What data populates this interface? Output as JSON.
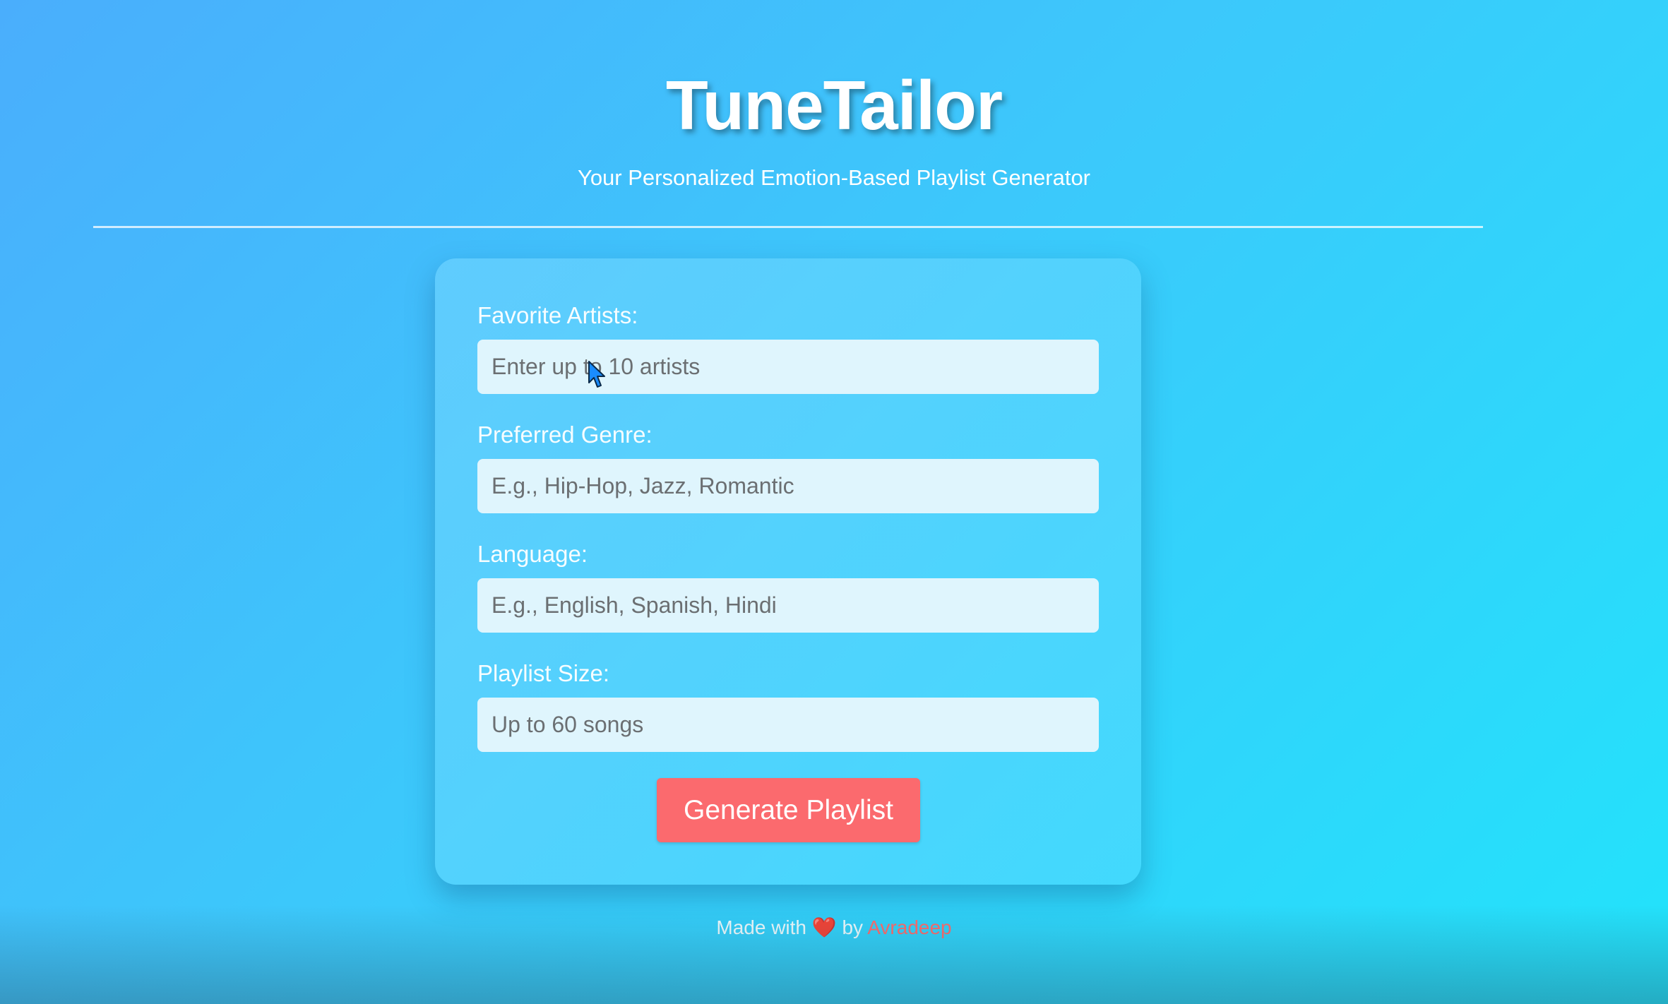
{
  "header": {
    "title": "TuneTailor",
    "subtitle": "Your Personalized Emotion-Based Playlist Generator"
  },
  "form": {
    "fields": [
      {
        "label": "Favorite Artists:",
        "placeholder": "Enter up to 10 artists"
      },
      {
        "label": "Preferred Genre:",
        "placeholder": "E.g., Hip-Hop, Jazz, Romantic"
      },
      {
        "label": "Language:",
        "placeholder": "E.g., English, Spanish, Hindi"
      },
      {
        "label": "Playlist Size:",
        "placeholder": "Up to 60 songs"
      }
    ],
    "submit_label": "Generate Playlist"
  },
  "footer": {
    "prefix": "Made with",
    "heart": "❤️",
    "by": "by",
    "author": "Avradeep"
  },
  "colors": {
    "background_start": "#4aaefc",
    "background_end": "#22e3fb",
    "button": "#fb6a6e",
    "input_bg": "#dff5fd",
    "author_link": "#ff6b6b"
  },
  "icons": {
    "cursor": "mouse-pointer-icon"
  }
}
